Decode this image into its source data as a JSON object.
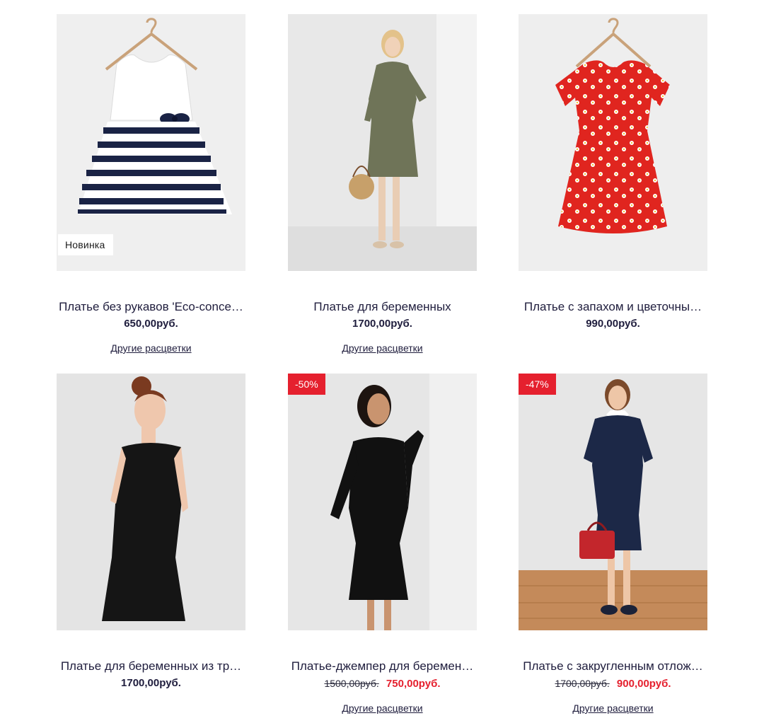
{
  "products": [
    {
      "title": "Платье без рукавов 'Eco-conce…",
      "price": "650,00руб.",
      "badge": "Новинка",
      "link": "Другие расцветки",
      "image_icon": "striped-dress-on-hanger"
    },
    {
      "title": "Платье для беременных",
      "price": "1700,00руб.",
      "link": "Другие расцветки",
      "image_icon": "model-in-khaki-shirt-dress"
    },
    {
      "title": "Платье с запахом и цветочны…",
      "price": "990,00руб.",
      "image_icon": "red-floral-dress-on-hanger"
    },
    {
      "title": "Платье для беременных из тр…",
      "price": "1700,00руб.",
      "image_icon": "model-in-black-dress-back-view"
    },
    {
      "title": "Платье-джемпер для беремен…",
      "old_price": "1500,00руб.",
      "new_price": "750,00руб.",
      "sale_badge": "-50%",
      "link": "Другие расцветки",
      "image_icon": "model-in-black-jumper-dress"
    },
    {
      "title": "Платье с закругленным отлож…",
      "old_price": "1700,00руб.",
      "new_price": "900,00руб.",
      "sale_badge": "-47%",
      "link": "Другие расцветки",
      "image_icon": "model-in-navy-dress-with-red-bag"
    }
  ],
  "colors": {
    "text": "#1f1d3d",
    "sale": "#e5202e",
    "image_bg": "#e6e6e6"
  }
}
